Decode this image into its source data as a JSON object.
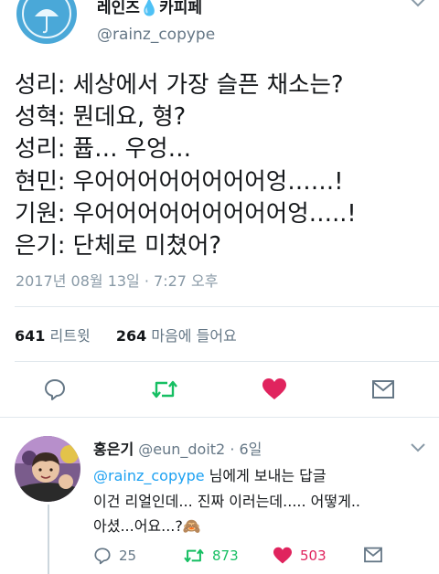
{
  "author": {
    "name_prefix": "레인즈",
    "name_drop": "💧",
    "name_suffix": "카피페",
    "handle": "@rainz_copype"
  },
  "tweet": {
    "lines": [
      "성리: 세상에서 가장 슬픈 채소는?",
      "성혁: 뭔데요, 형?",
      "성리: 퓹… 우엉…",
      "현민: 우어어어어어어어어엉……!",
      "기원: 우어어어어어어어어어엉…..!",
      "은기: 단체로 미쳤어?"
    ],
    "timestamp": "2017년 08월 13일 · 7:27 오후"
  },
  "stats": {
    "retweets_count": "641",
    "retweets_label": "리트윗",
    "likes_count": "264",
    "likes_label": "마음에 들어요"
  },
  "actions": {
    "reply_icon": "reply-icon",
    "retweet_icon": "retweet-icon",
    "like_icon": "heart-icon",
    "dm_icon": "mail-icon",
    "retweet_color": "#17bf63",
    "like_color": "#e0245e",
    "icon_color": "#657786"
  },
  "reply": {
    "name": "홍은기",
    "handle": "@eun_doit2",
    "time": "· 6일",
    "reply_to_mention": "@rainz_copype",
    "reply_to_suffix": " 님에게 보내는 답글",
    "text_line1": "이건 리얼인데... 진짜 이러는데..... 어떻게..",
    "text_line2": "아셨...어요...?🙈",
    "reply_count": "25",
    "retweet_count": "873",
    "like_count": "503"
  }
}
